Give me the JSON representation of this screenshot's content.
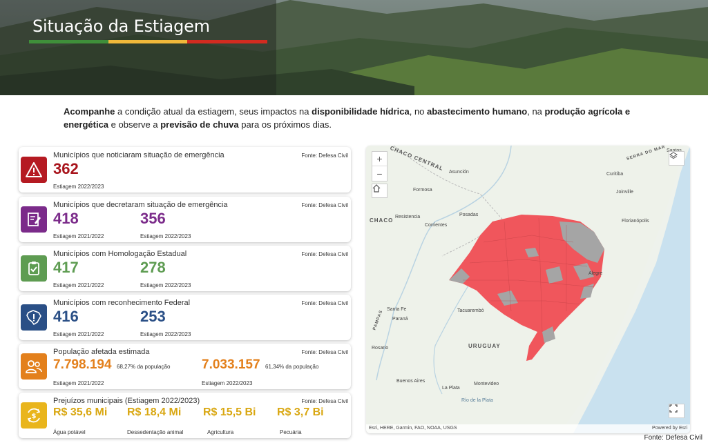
{
  "header": {
    "title": "Situação da Estiagem",
    "stripe_colors": [
      "#3f8f3a",
      "#f0b83a",
      "#d22b20"
    ]
  },
  "intro": {
    "part1": "Acompanhe",
    "part2": " a condição atual da estiagem, seus impactos na ",
    "part3": "disponibilidade hídrica",
    "part4": ", no ",
    "part5": "abastecimento humano",
    "part6": ", na ",
    "part7": "produção agrícola e energética",
    "part8": " e observe a ",
    "part9": "previsão de chuva",
    "part10": " para os próximos dias."
  },
  "cards": [
    {
      "title": "Municípios que noticiaram situação de emergência",
      "source": "Fonte: Defesa Civil",
      "color": "#b51a22",
      "icon": "warning-icon",
      "values": [
        {
          "value": "362",
          "label": "Estiagem 2022/2023"
        }
      ]
    },
    {
      "title": "Municípios que decretaram situação de emergência",
      "source": "Fonte: Defesa Civil",
      "color": "#7b2b8a",
      "icon": "document-sign-icon",
      "values": [
        {
          "value": "418",
          "label": "Estiagem 2021/2022"
        },
        {
          "value": "356",
          "label": "Estiagem 2022/2023"
        }
      ]
    },
    {
      "title": "Municípios com Homologação Estadual",
      "source": "Fonte: Defesa Civil",
      "color": "#5e9c52",
      "icon": "clipboard-check-icon",
      "values": [
        {
          "value": "417",
          "label": "Estiagem 2021/2022"
        },
        {
          "value": "278",
          "label": "Estiagem 2022/2023"
        }
      ]
    },
    {
      "title": "Municípios com reconhecimento Federal",
      "source": "Fonte: Defesa Civil",
      "color": "#2a4f86",
      "icon": "brazil-map-icon",
      "values": [
        {
          "value": "416",
          "label": "Estiagem 2021/2022"
        },
        {
          "value": "253",
          "label": "Estiagem 2022/2023"
        }
      ]
    },
    {
      "title": "População afetada estimada",
      "source": "Fonte: Defesa Civil",
      "color": "#e3801c",
      "icon": "people-icon",
      "values": [
        {
          "value": "7.798.194",
          "note": "68,27% da população",
          "label": "Estiagem 2021/2022"
        },
        {
          "value": "7.033.157",
          "note": "61,34% da população",
          "label": "Estiagem 2022/2023"
        }
      ]
    },
    {
      "title": "Prejuízos municipais (Estiagem 2022/2023)",
      "source": "Fonte: Defesa Civil",
      "color": "#e9b51c",
      "icon": "money-cycle-icon",
      "values": [
        {
          "value": "R$ 35,6 Mi",
          "label": "Água potável"
        },
        {
          "value": "R$ 18,4 Mi",
          "label": "Dessedentação animal"
        },
        {
          "value": "R$ 15,5 Bi",
          "label": "Agricultura"
        },
        {
          "value": "R$ 3,7 Bi",
          "label": "Pecuária"
        }
      ]
    }
  ],
  "map": {
    "labels": {
      "chaco_central": "CHACO CENTRAL",
      "asuncion": "Asunción",
      "formosa": "Formosa",
      "chaco": "CHACO",
      "resistencia": "Resistencia",
      "corrientes": "Corrientes",
      "posadas": "Posadas",
      "serra_do_mar": "SERRA DO MAR",
      "santos": "Santos",
      "curitiba": "Curitiba",
      "joinville": "Joinville",
      "florianopolis": "Florianópolis",
      "porto_alegre": "Alegre",
      "santa_fe": "Santa Fe",
      "parana": "Paraná",
      "pampas": "PAMPAS",
      "tacuarembo": "Tacuarembó",
      "uruguay": "URUGUAY",
      "rosario": "Rosario",
      "buenos_aires": "Buenos Aires",
      "montevideo": "Montevideo",
      "la_plata": "La Plata",
      "rio_de_la_plata": "Río de la Plata"
    },
    "attribution": "Esri, HERE, Garmin, FAO, NOAA, USGS",
    "powered_by": "Powered by Esri",
    "zoom_in": "+",
    "zoom_out": "−",
    "emergency_color": "#f0565c",
    "other_color": "#a5a5a5"
  },
  "footer": {
    "source": "Fonte: Defesa Civil"
  }
}
